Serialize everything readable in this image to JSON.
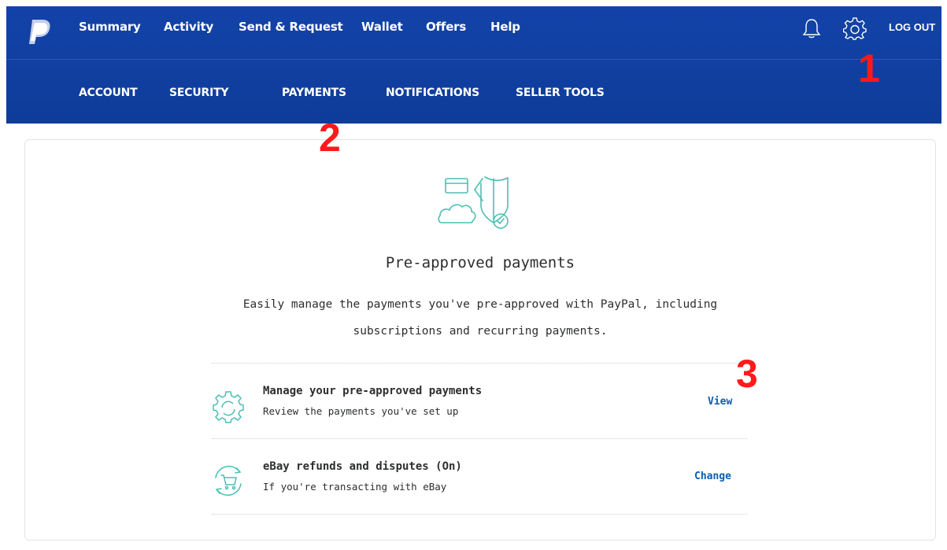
{
  "brand": {
    "logo_icon": "paypal-logo-icon",
    "header_color": "#0f3c9a",
    "accent_teal": "#4bbfb3",
    "link_color": "#0d5db0"
  },
  "nav": {
    "items": [
      "Summary",
      "Activity",
      "Send & Request",
      "Wallet",
      "Offers",
      "Help"
    ],
    "notifications_icon": "bell-icon",
    "settings_icon": "gear-icon",
    "logout_label": "LOG OUT"
  },
  "subnav": {
    "items": [
      "ACCOUNT",
      "SECURITY",
      "PAYMENTS",
      "NOTIFICATIONS",
      "SELLER TOOLS"
    ],
    "active": "PAYMENTS"
  },
  "annotations": [
    "1",
    "2",
    "3"
  ],
  "card": {
    "title": "Pre-approved payments",
    "description_line1": "Easily manage the payments you've pre-approved with PayPal, including",
    "description_line2": "subscriptions and recurring payments.",
    "rows": [
      {
        "icon": "gear-refresh-icon",
        "title": "Manage your pre-approved payments",
        "subtitle": "Review the payments you've set up",
        "action": "View"
      },
      {
        "icon": "cart-refresh-icon",
        "title": "eBay refunds and disputes (On)",
        "subtitle": "If you're transacting with eBay",
        "action": "Change"
      }
    ]
  }
}
